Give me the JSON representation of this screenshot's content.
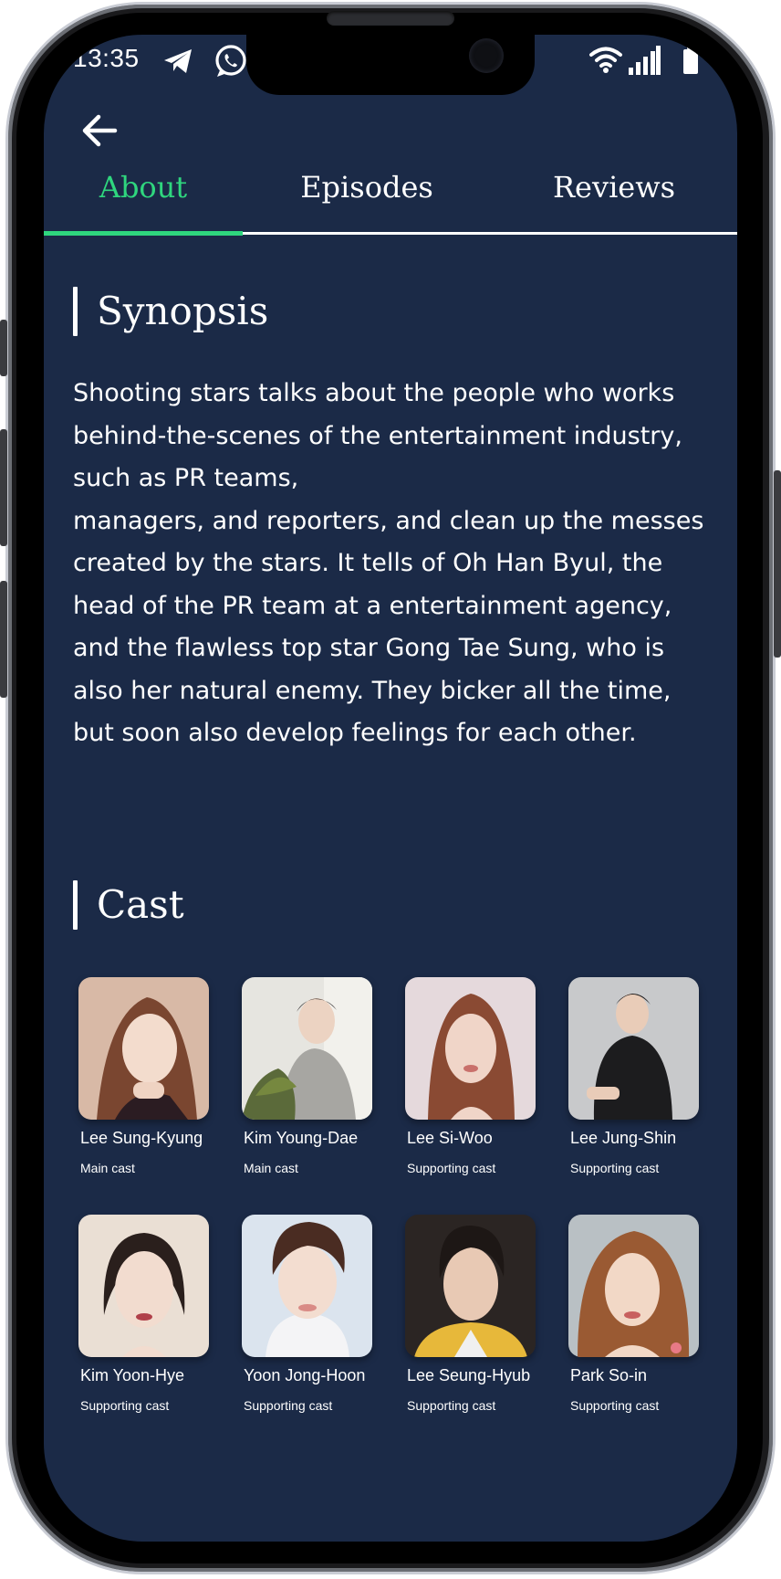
{
  "status_bar": {
    "time": "13:35",
    "icons": [
      "telegram-icon",
      "whatsapp-icon",
      "wifi-icon",
      "signal-icon",
      "battery-icon"
    ]
  },
  "header": {
    "back_icon": "arrow-left-icon",
    "tabs": [
      {
        "label": "About",
        "active": true
      },
      {
        "label": "Episodes",
        "active": false
      },
      {
        "label": "Reviews",
        "active": false
      }
    ]
  },
  "synopsis": {
    "title": "Synopsis",
    "text": "Shooting stars talks about the people who works behind-the-scenes of the entertainment industry, such as PR teams,\nmanagers, and reporters, and clean up the messes created by the stars. It tells of Oh Han Byul, the head of the PR team at a entertainment agency, and the flawless top star Gong Tae Sung, who is also her natural enemy. They bicker all the time, but soon also develop feelings for each other."
  },
  "cast": {
    "title": "Cast",
    "members": [
      {
        "name": "Lee Sung-Kyung",
        "role": "Main cast"
      },
      {
        "name": "Kim Young-Dae",
        "role": "Main cast"
      },
      {
        "name": "Lee Si-Woo",
        "role": "Supporting cast"
      },
      {
        "name": "Lee Jung-Shin",
        "role": "Supporting cast"
      },
      {
        "name": "Kim Yoon-Hye",
        "role": "Supporting cast"
      },
      {
        "name": "Yoon Jong-Hoon",
        "role": "Supporting cast"
      },
      {
        "name": "Lee Seung-Hyub",
        "role": "Supporting cast"
      },
      {
        "name": "Park So-in",
        "role": "Supporting cast"
      }
    ]
  },
  "colors": {
    "background": "#1b2a47",
    "accent": "#2fd67e",
    "text": "#ffffff"
  }
}
